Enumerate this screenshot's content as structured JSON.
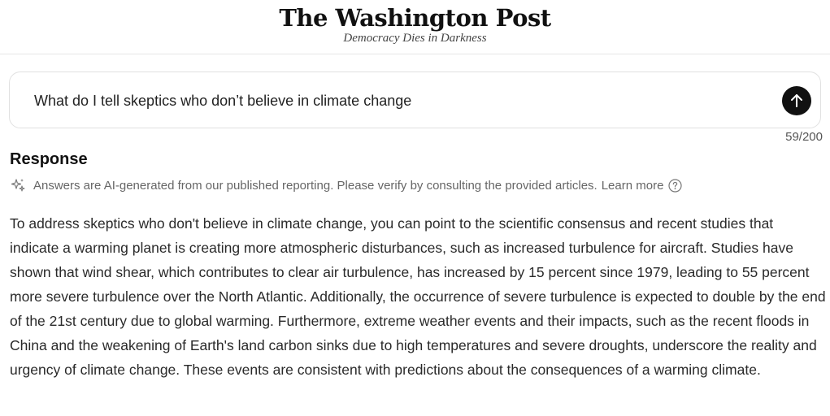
{
  "header": {
    "logo_text": "The Washington Post",
    "tagline": "Democracy Dies in Darkness"
  },
  "search": {
    "value": "What do I tell skeptics who don’t believe in climate change",
    "char_count": "59/200",
    "submit_icon": "arrow-up-icon"
  },
  "response": {
    "heading": "Response",
    "disclaimer": "Answers are AI-generated from our published reporting. Please verify by consulting the provided articles.",
    "learn_more_label": "Learn more",
    "body": "To address skeptics who don't believe in climate change, you can point to the scientific consensus and recent studies that indicate a warming planet is creating more atmospheric disturbances, such as increased turbulence for aircraft. Studies have shown that wind shear, which contributes to clear air turbulence, has increased by 15 percent since 1979, leading to 55 percent more severe turbulence over the North Atlantic. Additionally, the occurrence of severe turbulence is expected to double by the end of the 21st century due to global warming. Furthermore, extreme weather events and their impacts, such as the recent floods in China and the weakening of Earth's land carbon sinks due to high temperatures and severe droughts, underscore the reality and urgency of climate change. These events are consistent with predictions about the consequences of a warming climate."
  },
  "colors": {
    "submit_button": "#111111",
    "muted_text": "#666666",
    "border": "#e1e1e1"
  }
}
